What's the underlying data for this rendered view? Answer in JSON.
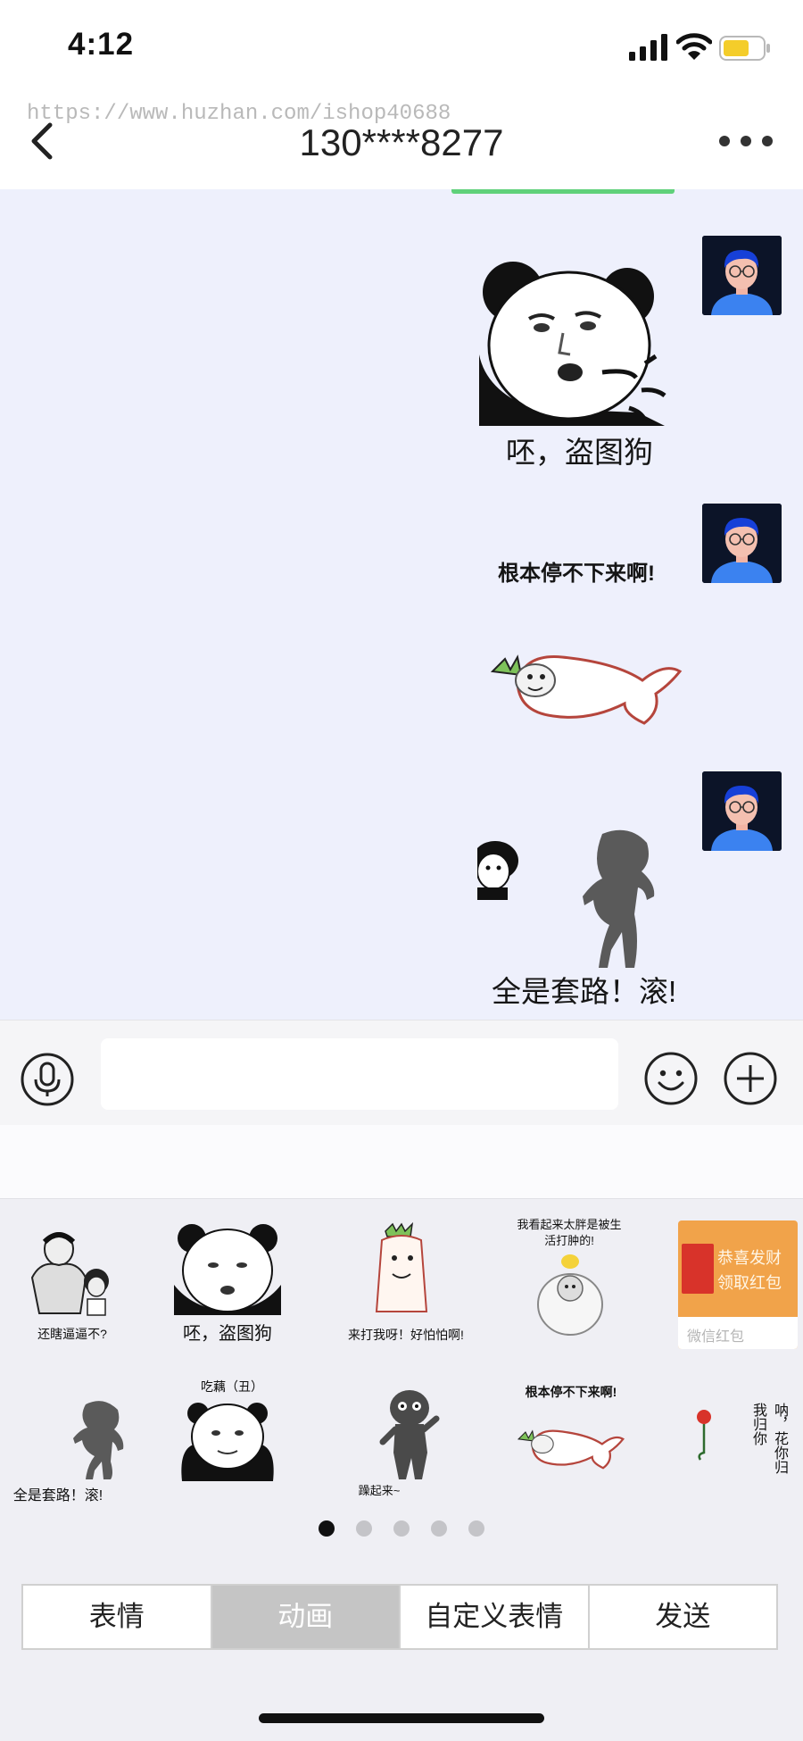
{
  "status_bar": {
    "time": "4:12"
  },
  "nav": {
    "watermark": "https://www.huzhan.com/ishop40688",
    "title": "130****8277"
  },
  "chat": {
    "messages": [
      {
        "caption": "呸，盗图狗"
      },
      {
        "caption": "根本停不下来啊!"
      },
      {
        "caption": ""
      },
      {
        "caption": "全是套路！滚!"
      }
    ]
  },
  "input": {
    "placeholder": ""
  },
  "panel": {
    "stickers_row1": [
      {
        "label": "还瞎逼逼不?"
      },
      {
        "label": "呸，盗图狗"
      },
      {
        "label": "来打我呀！好怕怕啊!"
      },
      {
        "label": "我看起来太胖是被生活打肿的!"
      }
    ],
    "red_packet": {
      "title": "恭喜发财",
      "subtitle": "领取红包",
      "footer": "微信红包"
    },
    "stickers_row2": [
      {
        "label": "全是套路！滚!"
      },
      {
        "label": "吃藕（丑）"
      },
      {
        "label": "躁起来~"
      },
      {
        "label": "根本停不下来啊!"
      },
      {
        "label": "呐，花你归我归你"
      }
    ],
    "pages": 5,
    "active_page": 1
  },
  "tabs": [
    {
      "label": "表情"
    },
    {
      "label": "动画"
    },
    {
      "label": "自定义表情"
    },
    {
      "label": "发送"
    }
  ],
  "colors": {
    "chat_bg": "#eef0fc",
    "selected_tab": "#c5c5c5",
    "red_packet": "#f1a34a",
    "avatar_shirt": "#3b82f0"
  }
}
